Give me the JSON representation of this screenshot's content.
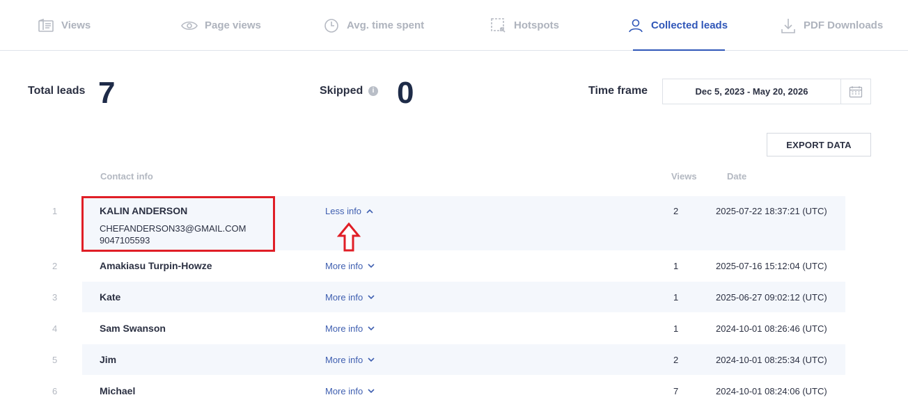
{
  "tabs": [
    {
      "label": "Views",
      "icon": "views-icon"
    },
    {
      "label": "Page views",
      "icon": "eye-icon"
    },
    {
      "label": "Avg. time spent",
      "icon": "clock-icon"
    },
    {
      "label": "Hotspots",
      "icon": "hotspot-icon"
    },
    {
      "label": "Collected leads",
      "icon": "person-icon",
      "active": true
    },
    {
      "label": "PDF Downloads",
      "icon": "download-icon"
    }
  ],
  "stats": {
    "total_label": "Total leads",
    "total_value": "7",
    "skipped_label": "Skipped",
    "skipped_value": "0",
    "timeframe_label": "Time frame",
    "timeframe_value": "Dec 5, 2023 - May 20, 2026"
  },
  "export_label": "EXPORT DATA",
  "table": {
    "headers": {
      "contact": "Contact info",
      "views": "Views",
      "date": "Date"
    },
    "rows": [
      {
        "num": "1",
        "name": "KALIN ANDERSON",
        "email": "CHEFANDERSON33@GMAIL.COM",
        "phone": "9047105593",
        "toggle": "Less info",
        "views": "2",
        "date": "2025-07-22 18:37:21 (UTC)"
      },
      {
        "num": "2",
        "name": "Amakiasu Turpin-Howze",
        "toggle": "More info",
        "views": "1",
        "date": "2025-07-16 15:12:04 (UTC)"
      },
      {
        "num": "3",
        "name": "Kate",
        "toggle": "More info",
        "views": "1",
        "date": "2025-06-27 09:02:12 (UTC)"
      },
      {
        "num": "4",
        "name": "Sam Swanson",
        "toggle": "More info",
        "views": "1",
        "date": "2024-10-01 08:26:46 (UTC)"
      },
      {
        "num": "5",
        "name": "Jim",
        "toggle": "More info",
        "views": "2",
        "date": "2024-10-01 08:25:34 (UTC)"
      },
      {
        "num": "6",
        "name": "Michael",
        "toggle": "More info",
        "views": "7",
        "date": "2024-10-01 08:24:06 (UTC)"
      }
    ]
  },
  "colors": {
    "accent": "#2f56b8",
    "highlight": "#e01e26",
    "row_shade": "#f4f7fc"
  }
}
